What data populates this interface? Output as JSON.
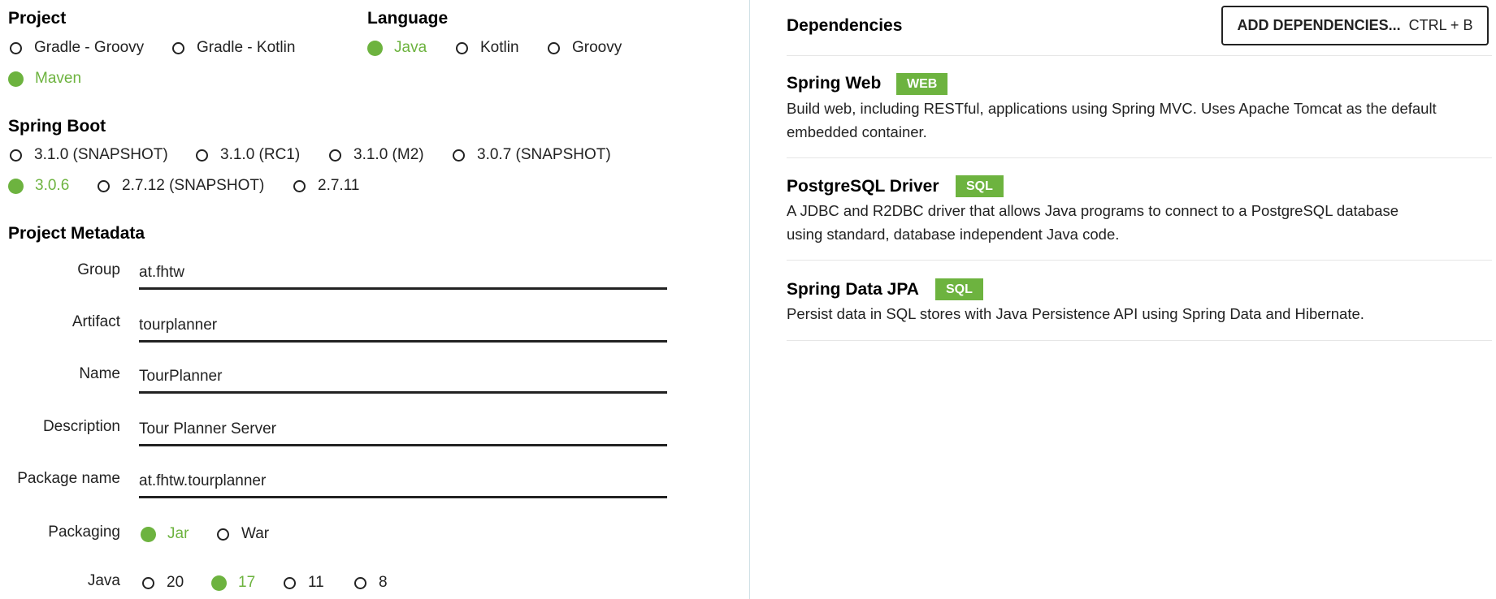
{
  "project": {
    "title": "Project",
    "options": [
      {
        "label": "Gradle - Groovy",
        "selected": false
      },
      {
        "label": "Gradle - Kotlin",
        "selected": false
      },
      {
        "label": "Maven",
        "selected": true
      }
    ]
  },
  "language": {
    "title": "Language",
    "options": [
      {
        "label": "Java",
        "selected": true
      },
      {
        "label": "Kotlin",
        "selected": false
      },
      {
        "label": "Groovy",
        "selected": false
      }
    ]
  },
  "spring_boot": {
    "title": "Spring Boot",
    "options": [
      {
        "label": "3.1.0 (SNAPSHOT)",
        "selected": false
      },
      {
        "label": "3.1.0 (RC1)",
        "selected": false
      },
      {
        "label": "3.1.0 (M2)",
        "selected": false
      },
      {
        "label": "3.0.7 (SNAPSHOT)",
        "selected": false
      },
      {
        "label": "3.0.6",
        "selected": true
      },
      {
        "label": "2.7.12 (SNAPSHOT)",
        "selected": false
      },
      {
        "label": "2.7.11",
        "selected": false
      }
    ]
  },
  "metadata": {
    "title": "Project Metadata",
    "fields": [
      {
        "label": "Group",
        "value": "at.fhtw"
      },
      {
        "label": "Artifact",
        "value": "tourplanner"
      },
      {
        "label": "Name",
        "value": "TourPlanner"
      },
      {
        "label": "Description",
        "value": "Tour Planner Server"
      },
      {
        "label": "Package name",
        "value": "at.fhtw.tourplanner"
      }
    ],
    "packaging": {
      "label": "Packaging",
      "options": [
        {
          "label": "Jar",
          "selected": true
        },
        {
          "label": "War",
          "selected": false
        }
      ]
    },
    "java": {
      "label": "Java",
      "options": [
        {
          "label": "20",
          "selected": false
        },
        {
          "label": "17",
          "selected": true
        },
        {
          "label": "11",
          "selected": false
        },
        {
          "label": "8",
          "selected": false
        }
      ]
    }
  },
  "dependencies": {
    "title": "Dependencies",
    "add_button_label": "ADD DEPENDENCIES...",
    "add_button_shortcut": "CTRL + B",
    "items": [
      {
        "name": "Spring Web",
        "tag": "WEB",
        "description": "Build web, including RESTful, applications using Spring MVC. Uses Apache Tomcat as the default embedded container."
      },
      {
        "name": "PostgreSQL Driver",
        "tag": "SQL",
        "description": "A JDBC and R2DBC driver that allows Java programs to connect to a PostgreSQL database using standard, database independent Java code."
      },
      {
        "name": "Spring Data JPA",
        "tag": "SQL",
        "description": "Persist data in SQL stores with Java Persistence API using Spring Data and Hibernate."
      }
    ]
  },
  "colors": {
    "accent": "#6db33f",
    "text": "#222222",
    "divider": "#cfe0e6"
  }
}
